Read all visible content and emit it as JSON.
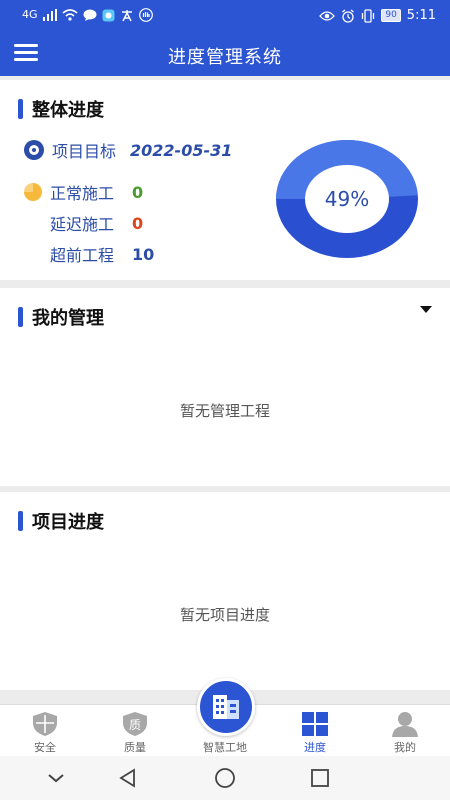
{
  "status_bar": {
    "network": "4G",
    "battery": "90",
    "time": "5:11"
  },
  "header": {
    "title": "进度管理系统",
    "menu_icon": "hamburger-menu-icon"
  },
  "overall": {
    "title": "整体进度",
    "target_label": "项目目标",
    "target_date": "2022-05-31",
    "stats": [
      {
        "label": "正常施工",
        "value": "0",
        "color": "#4a9a2c"
      },
      {
        "label": "延迟施工",
        "value": "0",
        "color": "#d9441c"
      },
      {
        "label": "超前工程",
        "value": "10",
        "color": "#2b4da8"
      }
    ],
    "progress_percent": 49,
    "progress_label": "49%"
  },
  "management": {
    "title": "我的管理",
    "empty_text": "暂无管理工程"
  },
  "project_progress": {
    "title": "项目进度",
    "empty_text": "暂无项目进度"
  },
  "tabs": [
    {
      "label": "安全",
      "icon": "shield-icon"
    },
    {
      "label": "质量",
      "icon": "quality-badge-icon"
    },
    {
      "label": "智慧工地",
      "icon": "building-icon"
    },
    {
      "label": "进度",
      "icon": "grid-icon",
      "active": true
    },
    {
      "label": "我的",
      "icon": "user-icon"
    }
  ],
  "colors": {
    "primary": "#2c55d3",
    "text_blue": "#2b4da8",
    "inactive_icon": "#a8a8a8"
  }
}
